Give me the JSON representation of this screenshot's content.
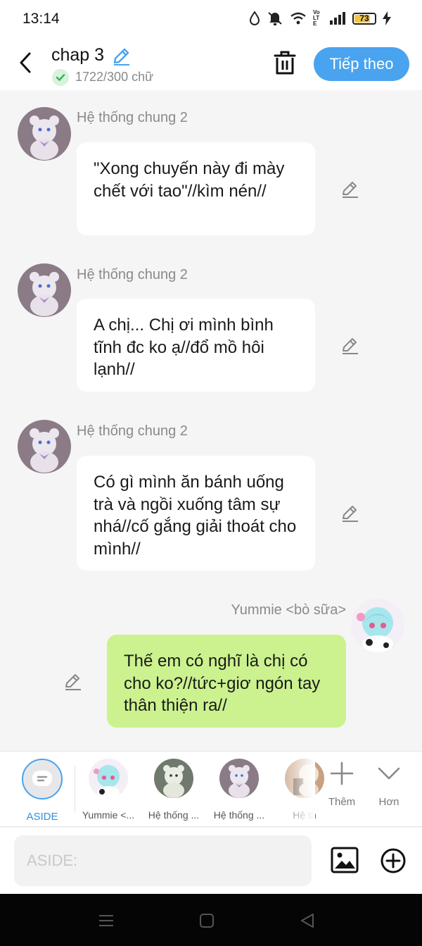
{
  "status_bar": {
    "time": "13:14",
    "battery": "73",
    "network": "VoLTE",
    "icons": [
      "alarm-icon",
      "vibrate-off-icon",
      "wifi-icon",
      "volte-icon",
      "signal-icon",
      "battery-icon",
      "charging-icon"
    ]
  },
  "header": {
    "title": "chap 3",
    "word_count": "1722/300 chữ",
    "next_label": "Tiếp theo",
    "accent_color": "#4aa3ef"
  },
  "messages": [
    {
      "sender": "Hệ thống chung 2",
      "text": "\"Xong chuyến này đi mày chết với tao\"//kìm nén//",
      "side": "left"
    },
    {
      "sender": "Hệ thống chung 2",
      "text": "A chị... Chị ơi mình bình tĩnh đc ko ạ//đổ mồ hôi lạnh//",
      "side": "left"
    },
    {
      "sender": "Hệ thống chung 2",
      "text": "Có gì mình ăn bánh uống trà và ngồi xuống tâm sự nhá//cố gắng giải thoát cho mình//",
      "side": "left"
    },
    {
      "sender": "Yummie <bò sữa>",
      "text": "Thế em có nghĩ là chị có cho ko?//tức+giơ ngón tay thân thiện ra//",
      "side": "right"
    }
  ],
  "characters": {
    "aside_label": "ASIDE",
    "items": [
      "Yummie <...",
      "Hệ thống ...",
      "Hệ thống ...",
      "Hệ th"
    ],
    "add_label": "Thêm",
    "more_label": "Hơn"
  },
  "input": {
    "placeholder": "ASIDE:"
  },
  "colors": {
    "my_bubble": "#cbf28e",
    "other_bubble": "#ffffff",
    "background": "#f5f5f5"
  }
}
